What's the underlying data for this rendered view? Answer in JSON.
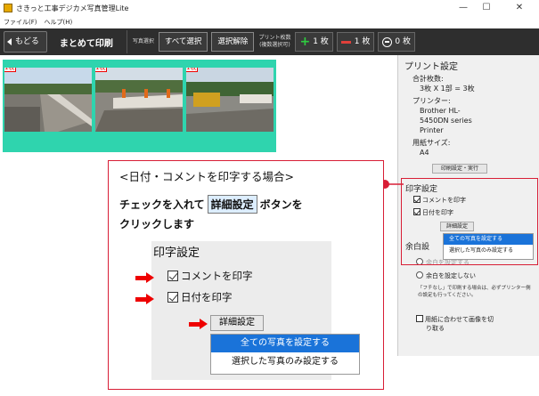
{
  "window": {
    "title": "さきっと工事デジカメ写真管理Lite",
    "controls": {
      "minimize": "—",
      "maximize": "☐",
      "close": "✕"
    }
  },
  "menu": [
    "ファイル(F)",
    "ヘルプ(H)"
  ],
  "toolbar": {
    "back_label": "もどる",
    "title": "まとめて印刷",
    "photo_select_label": "写真選択",
    "select_all_label": "すべて選択",
    "deselect_label": "選択解除",
    "print_count_label": "プリント枚数",
    "print_count_sub": "(複数選択可)",
    "plus_label": "1 枚",
    "minus_label": "1 枚",
    "zero_label": "0 枚"
  },
  "photos": [
    {
      "tag": "1枚"
    },
    {
      "tag": "1枚"
    },
    {
      "tag": "1枚"
    }
  ],
  "panel": {
    "print_settings_title": "プリント設定",
    "total_label": "合計枚数:",
    "total_value": "3枚 X 1部 = 3枚",
    "printer_label": "プリンター:",
    "printer_value_1": "Brother HL-",
    "printer_value_2": "5450DN series",
    "printer_value_3": "Printer",
    "paper_label": "用紙サイズ:",
    "paper_value": "A4",
    "print_exec_button": "印刷設定・実行",
    "imprint_title": "印字設定",
    "comment_label": "コメントを印字",
    "date_label": "日付を印字",
    "detail_button": "詳細設定",
    "menu_all": "全ての写真を設定する",
    "menu_selected": "選択した写真のみ設定する",
    "margin_title": "余白設",
    "margin_opt1": "余白を設定する",
    "margin_opt2": "余白を設定しない",
    "note": "「フチなし」で印刷する場合は、必ずプリンター側の設定も行ってください。",
    "fit_label_1": "用紙に合わせて画像を切",
    "fit_label_2": "り取る"
  },
  "callout": {
    "heading": "<日付・コメントを印字する場合>",
    "line1_pre": "チェックを入れて",
    "line1_btn": "詳細設定",
    "line1_post": "ボタンを",
    "line2": "クリックします",
    "zoom_title": "印字設定",
    "zoom_comment": "コメントを印字",
    "zoom_date": "日付を印字",
    "zoom_detail": "詳細設定",
    "zoom_menu_all": "全ての写真を設定する",
    "zoom_menu_selected": "選択した写真のみ設定する"
  },
  "colors": {
    "accent": "#d81e36",
    "strip": "#2fd4ae",
    "menu_highlight": "#1a73d9"
  }
}
